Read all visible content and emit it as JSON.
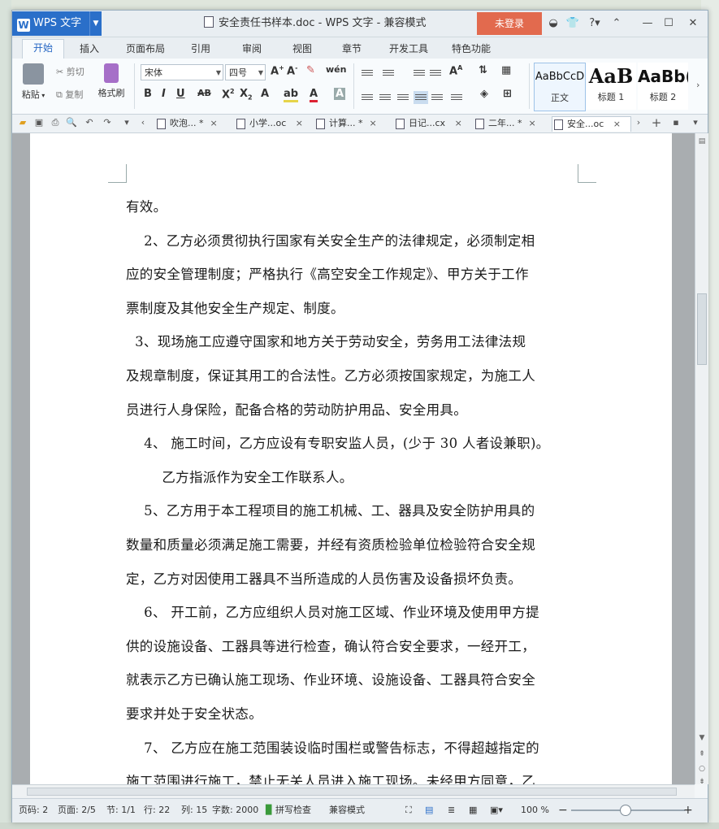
{
  "app": {
    "name": "WPS 文字",
    "document_title": "安全责任书样本.doc - WPS 文字 - 兼容模式",
    "login_label": "未登录",
    "window_buttons": [
      "minimize",
      "maximize",
      "close"
    ]
  },
  "menu": {
    "tabs": [
      "开始",
      "插入",
      "页面布局",
      "引用",
      "审阅",
      "视图",
      "章节",
      "开发工具",
      "特色功能"
    ],
    "active": "开始"
  },
  "ribbon": {
    "paste": "粘贴",
    "cut": "剪切",
    "copy": "复制",
    "format_painter": "格式刷",
    "font_name": "宋体",
    "font_size": "四号",
    "styles": [
      {
        "sample": "AaBbCcD",
        "label": "正文"
      },
      {
        "sample": "AaB",
        "label": "标题 1"
      },
      {
        "sample": "AaBb(",
        "label": "标题 2"
      }
    ]
  },
  "doc_tabs": [
    {
      "label": "吹泡...",
      "close": "×",
      "star": "*"
    },
    {
      "label": "小学...oc",
      "close": "×",
      "star": ""
    },
    {
      "label": "计算...",
      "close": "×",
      "star": "*"
    },
    {
      "label": "日记...cx",
      "close": "×",
      "star": ""
    },
    {
      "label": "二年...",
      "close": "×",
      "star": "*"
    },
    {
      "label": "安全...oc",
      "close": "×",
      "star": ""
    }
  ],
  "document": {
    "lines": [
      "有效。",
      "    2、乙方必须贯彻执行国家有关安全生产的法律规定，必须制定相",
      "应的安全管理制度；严格执行《高空安全工作规定》、甲方关于工作",
      "票制度及其他安全生产规定、制度。",
      "  3、现场施工应遵守国家和地方关于劳动安全，劳务用工法律法规",
      "及规章制度，保证其用工的合法性。乙方必须按国家规定，为施工人",
      "员进行人身保险，配备合格的劳动防护用品、安全用具。",
      "    4、 施工时间，乙方应设有专职安监人员，(少于 30 人者设兼职)。",
      "        乙方指派作为安全工作联系人。",
      "    5、乙方用于本工程项目的施工机械、工、器具及安全防护用具的",
      "数量和质量必须满足施工需要，并经有资质检验单位检验符合安全规",
      "定，乙方对因使用工器具不当所造成的人员伤害及设备损坏负责。",
      "    6、 开工前，乙方应组织人员对施工区域、作业环境及使用甲方提",
      "供的设施设备、工器具等进行检查，确认符合安全要求，一经开工，",
      "就表示乙方已确认施工现场、作业环境、设施设备、工器具符合安全",
      "要求并处于安全状态。",
      "    7、 乙方应在施工范围装设临时围栏或警告标志，不得超越指定的",
      "施工范围进行施工，禁止无关人员进入施工现场。未经甲方同意，乙"
    ]
  },
  "status": {
    "page_code": "页码: 2",
    "pages": "页面: 2/5",
    "section": "节: 1/1",
    "row": "行: 22",
    "col": "列: 15",
    "words": "字数: 2000",
    "spell": "拼写检查",
    "compat": "兼容模式",
    "zoom": "100 %",
    "zoom_level": 1.0
  },
  "colors": {
    "accent": "#2a6fc9",
    "login": "#e26a4e"
  }
}
